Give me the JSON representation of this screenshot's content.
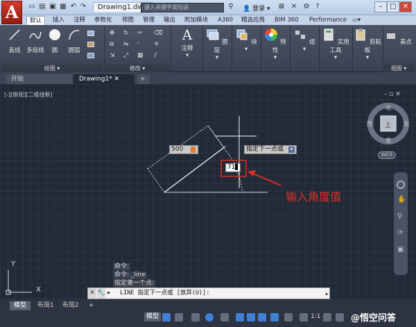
{
  "app": {
    "logo": "A",
    "title": "Drawing1.dwg",
    "search_placeholder": "键入关键字或短语",
    "login": "登录"
  },
  "ribbon_tabs": [
    "默认",
    "插入",
    "注释",
    "参数化",
    "视图",
    "管理",
    "输出",
    "附加模块",
    "A360",
    "精选应用",
    "BIM 360",
    "Performance"
  ],
  "ribbon": {
    "draw_tools": [
      "直线",
      "多段线",
      "圆",
      "圆弧"
    ],
    "groups": [
      "绘图",
      "修改"
    ],
    "big_buttons": [
      "注释",
      "图层",
      "块",
      "特性",
      "组",
      "实用工具",
      "剪贴板",
      "基点"
    ],
    "view_group": "视图"
  },
  "file_tabs": [
    "开始",
    "Drawing1*"
  ],
  "viewport_label": "[-][俯视][二维线框]",
  "viewcube": {
    "north": "北",
    "south": "南",
    "west": "西",
    "east": "东",
    "center": "上",
    "wcs": "WCS"
  },
  "drawing": {
    "length_value": "500",
    "prompt": "指定下一点或",
    "angle_value": "71",
    "annotation": "输入角度值"
  },
  "command": {
    "history": [
      "命令:",
      "命令: _line",
      "指定第一个点:"
    ],
    "line": "LINE 指定下一点或 [放弃(U)]:"
  },
  "layout_tabs": [
    "模型",
    "布局1",
    "布局2"
  ],
  "status": {
    "model": "模型"
  },
  "watermark": "@悟空问答",
  "colors": {
    "accent_red": "#d9301e",
    "ribbon_bg": "#3f4757",
    "canvas_bg": "#222a38"
  }
}
